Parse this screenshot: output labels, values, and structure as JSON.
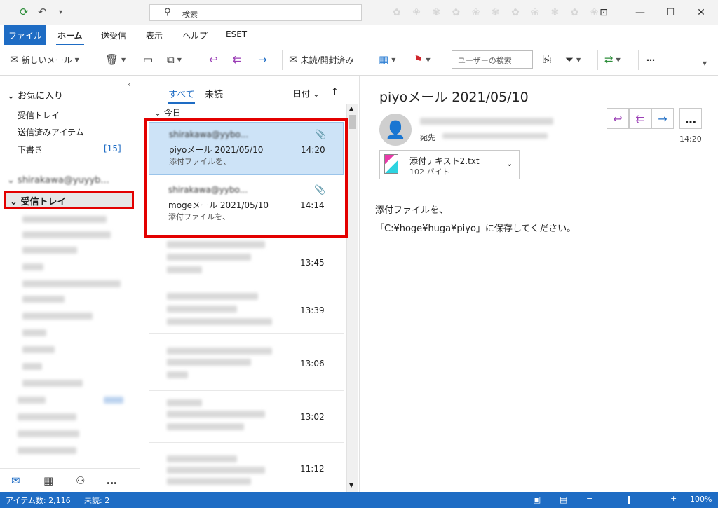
{
  "titlebar": {
    "search_placeholder": "検索"
  },
  "menu": {
    "file": "ファイル",
    "home": "ホーム",
    "send_receive": "送受信",
    "view": "表示",
    "help": "ヘルプ",
    "eset": "ESET"
  },
  "ribbon": {
    "new_mail": "新しいメール",
    "unread_read": "未読/開封済み",
    "user_search_placeholder": "ユーザーの検索",
    "more": "…"
  },
  "sidebar": {
    "favorites": "お気に入り",
    "items": [
      {
        "label": "受信トレイ"
      },
      {
        "label": "送信済みアイテム"
      },
      {
        "label": "下書き",
        "count": "[15]"
      }
    ],
    "account_name": "shirakawa@yuyyb...",
    "inbox_label": "受信トレイ"
  },
  "list": {
    "tab_all": "すべて",
    "tab_unread": "未読",
    "sort_label": "日付",
    "group_today": "今日",
    "messages": [
      {
        "from": "shirakawa@yybo...",
        "subject": "piyoメール  2021/05/10",
        "preview": "添付ファイルを、",
        "time": "14:20",
        "attachment": true
      },
      {
        "from": "shirakawa@yybo...",
        "subject": "mogeメール  2021/05/10",
        "preview": "添付ファイルを、",
        "time": "14:14",
        "attachment": true
      },
      {
        "time": "13:45"
      },
      {
        "time": "13:39"
      },
      {
        "time": "13:06"
      },
      {
        "time": "13:02"
      },
      {
        "time": "11:12"
      }
    ]
  },
  "reading": {
    "title": "piyoメール  2021/05/10",
    "to_label": "宛先",
    "time": "14:20",
    "attachment_name": "添付テキスト2.txt",
    "attachment_size": "102 バイト",
    "body_line1": "添付ファイルを、",
    "body_line2": "「C:¥hoge¥huga¥piyo」に保存してください。"
  },
  "status": {
    "items_count": "アイテム数: 2,116",
    "unread_count": "未読: 2",
    "zoom": "100%"
  },
  "colors": {
    "accent": "#1e6cc4",
    "highlight": "#e30000",
    "selected_row": "#cde3f7"
  }
}
